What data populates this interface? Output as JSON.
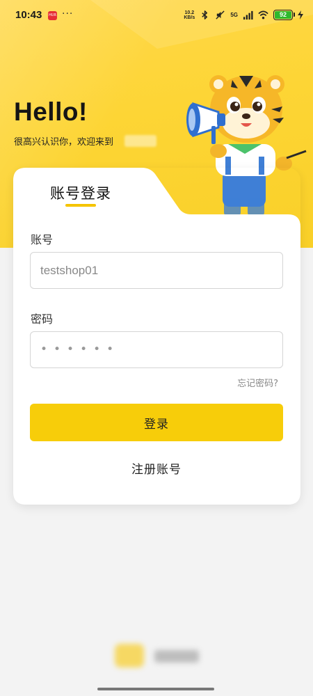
{
  "status_bar": {
    "time": "10:43",
    "app_icon_label": "HUR",
    "overflow": "···",
    "net_speed_value": "10.2",
    "net_speed_unit": "KB/s",
    "network_type": "5G",
    "battery": "92",
    "icons": [
      "bluetooth-icon",
      "mute-icon",
      "signal-icon",
      "wifi-icon",
      "battery-icon",
      "charging-icon"
    ]
  },
  "greeting": {
    "title": "Hello!",
    "subtitle": "很高兴认识你，欢迎来到"
  },
  "login_card": {
    "tab_label": "账号登录",
    "account_label": "账号",
    "account_value": "testshop01",
    "password_label": "密码",
    "password_mask": "••••••",
    "forgot_password": "忘记密码?",
    "login_button": "登录",
    "register_link": "注册账号"
  },
  "colors": {
    "brand_yellow": "#f7cd0a",
    "hero_yellow": "#fdd535",
    "background": "#f3f3f3",
    "card": "#ffffff"
  }
}
